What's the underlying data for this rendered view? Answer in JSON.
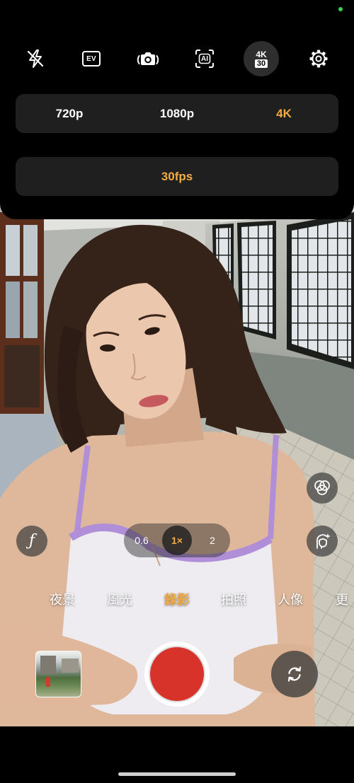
{
  "status": {
    "privacy_indicator": "camera-in-use-dot"
  },
  "top_bar": {
    "icons": [
      "flash-off-icon",
      "ev-icon",
      "live-photo-icon",
      "ai-scene-icon",
      "video-format-badge",
      "settings-gear-icon"
    ],
    "ev_label": "EV",
    "ai_label": "AI",
    "video_format": {
      "resolution": "4K",
      "fps": "30"
    }
  },
  "resolution_options": [
    {
      "label": "720p",
      "selected": false
    },
    {
      "label": "1080p",
      "selected": false
    },
    {
      "label": "4K",
      "selected": true
    }
  ],
  "fps_options": [
    {
      "label": "30fps",
      "selected": true
    }
  ],
  "controls": {
    "aperture_label": "ƒ",
    "filter_icon": "filters-icon",
    "beauty_icon": "face-beauty-icon",
    "switch_icon": "switch-camera-icon"
  },
  "zoom": {
    "options": [
      {
        "label": "0.6",
        "selected": false
      },
      {
        "label": "1×",
        "selected": true
      },
      {
        "label": "2",
        "selected": false
      }
    ]
  },
  "modes": [
    {
      "label": "夜景",
      "selected": false
    },
    {
      "label": "風光",
      "selected": false
    },
    {
      "label": "錄影",
      "selected": true
    },
    {
      "label": "拍照",
      "selected": false
    },
    {
      "label": "人像",
      "selected": false
    },
    {
      "label": "更",
      "selected": false
    }
  ],
  "colors": {
    "accent": "#f2ab46",
    "shutter": "#d7332b",
    "panel": "#1f1f1f",
    "indicator": "#32d74b"
  }
}
